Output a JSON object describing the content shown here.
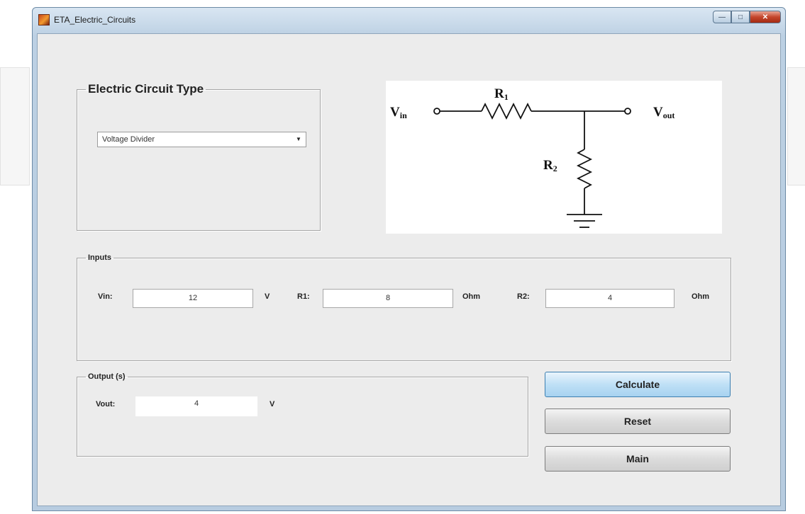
{
  "window": {
    "title": "ETA_Electric_Circuits"
  },
  "circuit_type": {
    "legend": "Electric Circuit Type",
    "selected": "Voltage Divider"
  },
  "diagram": {
    "vin": {
      "main": "V",
      "sub": "in"
    },
    "vout": {
      "main": "V",
      "sub": "out"
    },
    "r1": {
      "main": "R",
      "sub": "1"
    },
    "r2": {
      "main": "R",
      "sub": "2"
    }
  },
  "inputs": {
    "legend": "Inputs",
    "vin": {
      "label": "Vin:",
      "value": "12",
      "unit": "V"
    },
    "r1": {
      "label": "R1:",
      "value": "8",
      "unit": "Ohm"
    },
    "r2": {
      "label": "R2:",
      "value": "4",
      "unit": "Ohm"
    }
  },
  "output": {
    "legend": "Output (s)",
    "vout": {
      "label": "Vout:",
      "value": "4",
      "unit": "V"
    }
  },
  "buttons": {
    "calculate": "Calculate",
    "reset": "Reset",
    "main": "Main"
  },
  "colors": {
    "window_frame": "#b7cce0",
    "panel_bg": "#ececec",
    "close_button": "#c5462c",
    "primary_button": "#a7d2f0"
  }
}
